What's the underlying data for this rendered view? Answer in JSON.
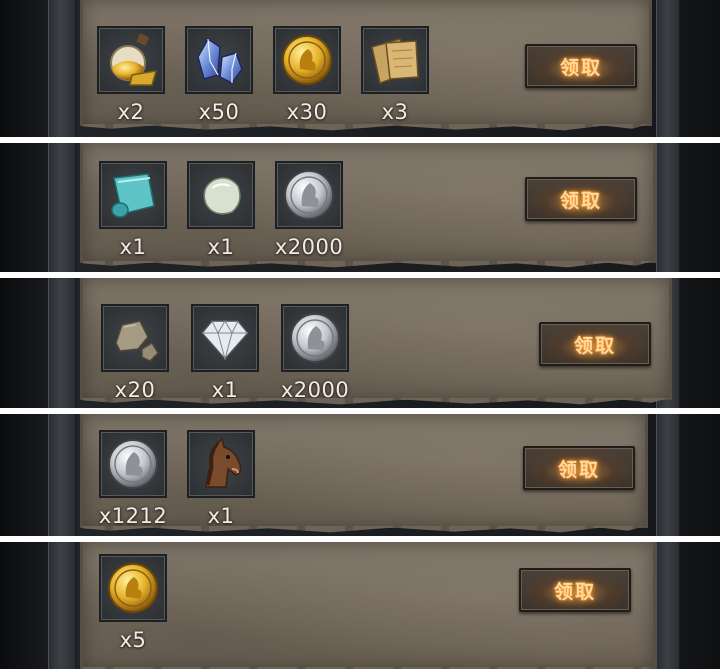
{
  "claim_label": "领取",
  "rows": [
    {
      "items": [
        {
          "icon": "gold-dust-flask-icon",
          "qty": "x2"
        },
        {
          "icon": "blue-crystal-icon",
          "qty": "x50"
        },
        {
          "icon": "gold-coin-icon",
          "qty": "x30"
        },
        {
          "icon": "parchment-scroll-icon",
          "qty": "x3"
        }
      ]
    },
    {
      "items": [
        {
          "icon": "cyan-cloth-roll-icon",
          "qty": "x1"
        },
        {
          "icon": "white-stone-icon",
          "qty": "x1"
        },
        {
          "icon": "silver-coin-icon",
          "qty": "x2000"
        }
      ]
    },
    {
      "items": [
        {
          "icon": "stone-ore-icon",
          "qty": "x20"
        },
        {
          "icon": "diamond-icon",
          "qty": "x1"
        },
        {
          "icon": "silver-coin-icon",
          "qty": "x2000"
        }
      ]
    },
    {
      "items": [
        {
          "icon": "silver-coin-icon",
          "qty": "x1212"
        },
        {
          "icon": "horse-head-icon",
          "qty": "x1"
        }
      ]
    },
    {
      "items": [
        {
          "icon": "gold-coin-icon",
          "qty": "x5"
        }
      ]
    }
  ],
  "colors": {
    "claim_glow": "#ff9d2c",
    "claim_text": "#ffd9a0",
    "panel": "#74695d",
    "qty_text": "#f1ede6"
  }
}
